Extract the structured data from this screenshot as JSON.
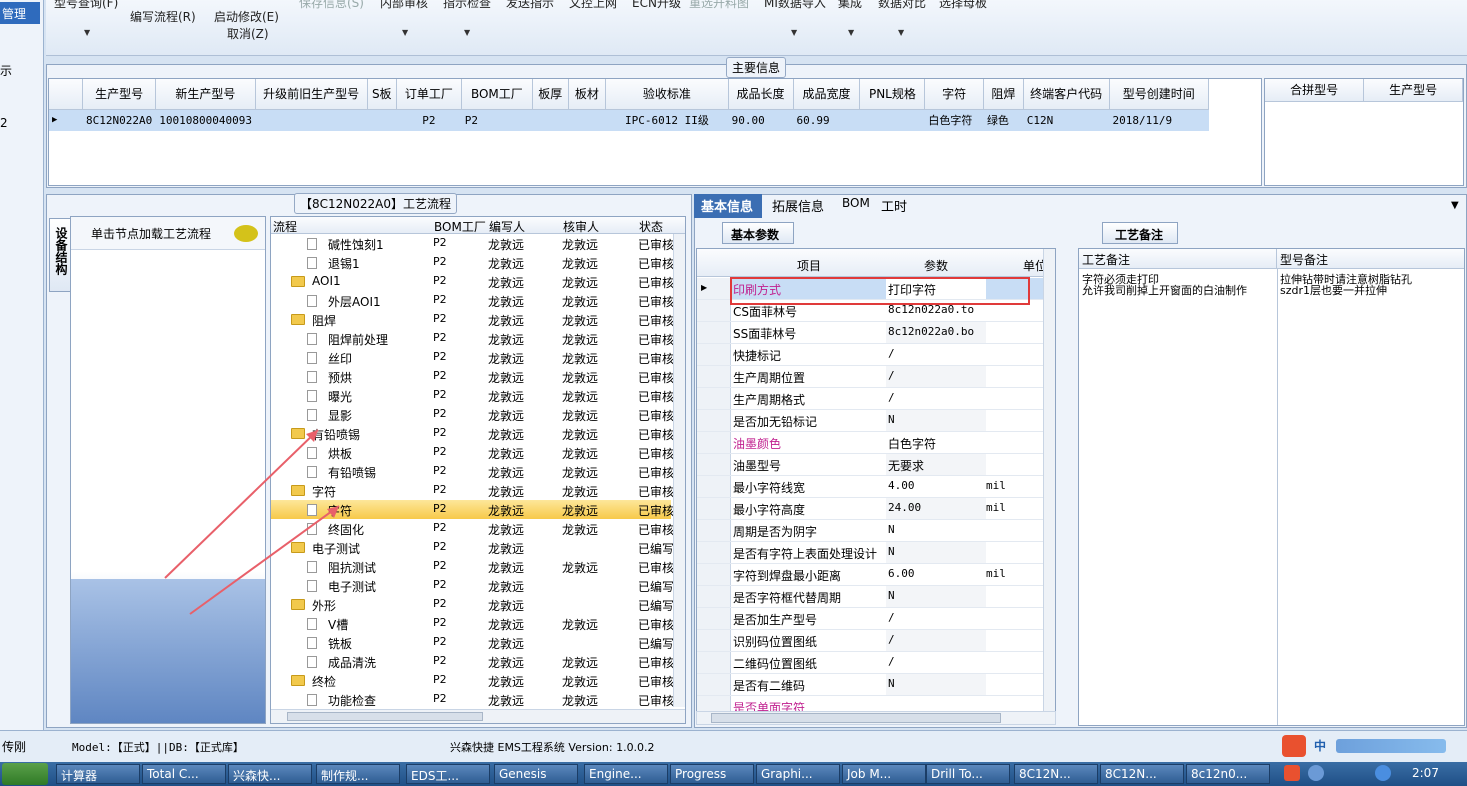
{
  "left_strip": {
    "selected": "管理",
    "item1": "示",
    "item2": "2"
  },
  "toolbar": {
    "items": [
      {
        "label": "型号查询(F)",
        "disabled": false
      },
      {
        "label": "编写流程(R)",
        "disabled": false
      },
      {
        "label": "启动修改(E)",
        "disabled": false
      },
      {
        "label": "取消(Z)",
        "disabled": false
      },
      {
        "label": "保存信息(S)",
        "disabled": true
      },
      {
        "label": "内部审核",
        "disabled": false
      },
      {
        "label": "指示检查",
        "disabled": false
      },
      {
        "label": "发送指示",
        "disabled": false
      },
      {
        "label": "文控上网",
        "disabled": false
      },
      {
        "label": "ECN升级",
        "disabled": false
      },
      {
        "label": "重选开料图",
        "disabled": true
      },
      {
        "label": "MI数据导入",
        "disabled": false
      },
      {
        "label": "集成",
        "disabled": false
      },
      {
        "label": "数据对比",
        "disabled": false
      },
      {
        "label": "选择母板",
        "disabled": false
      }
    ]
  },
  "main_info": {
    "title": "主要信息",
    "columns": [
      "生产型号",
      "新生产型号",
      "升级前旧生产型号",
      "S板",
      "订单工厂",
      "BOM工厂",
      "板厚",
      "板材",
      "验收标准",
      "成品长度",
      "成品宽度",
      "PNL规格",
      "字符",
      "阻焊",
      "终端客户代码",
      "型号创建时间"
    ],
    "row": [
      "8C12N022A0",
      "10010800040093",
      "",
      "",
      "P2",
      "P2",
      "",
      "",
      "IPC-6012 II级",
      "90.00",
      "60.99",
      "",
      "白色字符",
      "绿色",
      "C12N",
      "2018/11/9"
    ],
    "side_columns": [
      "合拼型号",
      "生产型号"
    ]
  },
  "process": {
    "title": "【8C12N022A0】工艺流程",
    "side_tab": "设备结构",
    "hint": "单击节点加载工艺流程",
    "columns": [
      "流程",
      "BOM工厂",
      "编写人",
      "核审人",
      "状态"
    ],
    "rows": [
      {
        "name": "碱性蚀刻1",
        "level": 2,
        "bom": "P2",
        "writer": "龙敦远",
        "checker": "龙敦远",
        "status": "已审核",
        "folder": false
      },
      {
        "name": "退锡1",
        "level": 2,
        "bom": "P2",
        "writer": "龙敦远",
        "checker": "龙敦远",
        "status": "已审核",
        "folder": false
      },
      {
        "name": "AOI1",
        "level": 1,
        "bom": "P2",
        "writer": "龙敦远",
        "checker": "龙敦远",
        "status": "已审核",
        "folder": true
      },
      {
        "name": "外层AOI1",
        "level": 2,
        "bom": "P2",
        "writer": "龙敦远",
        "checker": "龙敦远",
        "status": "已审核",
        "folder": false
      },
      {
        "name": "阻焊",
        "level": 1,
        "bom": "P2",
        "writer": "龙敦远",
        "checker": "龙敦远",
        "status": "已审核",
        "folder": true
      },
      {
        "name": "阻焊前处理",
        "level": 2,
        "bom": "P2",
        "writer": "龙敦远",
        "checker": "龙敦远",
        "status": "已审核",
        "folder": false
      },
      {
        "name": "丝印",
        "level": 2,
        "bom": "P2",
        "writer": "龙敦远",
        "checker": "龙敦远",
        "status": "已审核",
        "folder": false
      },
      {
        "name": "预烘",
        "level": 2,
        "bom": "P2",
        "writer": "龙敦远",
        "checker": "龙敦远",
        "status": "已审核",
        "folder": false
      },
      {
        "name": "曝光",
        "level": 2,
        "bom": "P2",
        "writer": "龙敦远",
        "checker": "龙敦远",
        "status": "已审核",
        "folder": false
      },
      {
        "name": "显影",
        "level": 2,
        "bom": "P2",
        "writer": "龙敦远",
        "checker": "龙敦远",
        "status": "已审核",
        "folder": false
      },
      {
        "name": "有铅喷锡",
        "level": 1,
        "bom": "P2",
        "writer": "龙敦远",
        "checker": "龙敦远",
        "status": "已审核",
        "folder": true
      },
      {
        "name": "烘板",
        "level": 2,
        "bom": "P2",
        "writer": "龙敦远",
        "checker": "龙敦远",
        "status": "已审核",
        "folder": false
      },
      {
        "name": "有铅喷锡",
        "level": 2,
        "bom": "P2",
        "writer": "龙敦远",
        "checker": "龙敦远",
        "status": "已审核",
        "folder": false
      },
      {
        "name": "字符",
        "level": 1,
        "bom": "P2",
        "writer": "龙敦远",
        "checker": "龙敦远",
        "status": "已审核",
        "folder": true
      },
      {
        "name": "字符",
        "level": 2,
        "bom": "P2",
        "writer": "龙敦远",
        "checker": "龙敦远",
        "status": "已审核",
        "folder": false,
        "selected": true
      },
      {
        "name": "终固化",
        "level": 2,
        "bom": "P2",
        "writer": "龙敦远",
        "checker": "龙敦远",
        "status": "已审核",
        "folder": false
      },
      {
        "name": "电子测试",
        "level": 1,
        "bom": "P2",
        "writer": "龙敦远",
        "checker": "",
        "status": "已编写",
        "folder": true
      },
      {
        "name": "阻抗测试",
        "level": 2,
        "bom": "P2",
        "writer": "龙敦远",
        "checker": "龙敦远",
        "status": "已审核",
        "folder": false
      },
      {
        "name": "电子测试",
        "level": 2,
        "bom": "P2",
        "writer": "龙敦远",
        "checker": "",
        "status": "已编写",
        "folder": false
      },
      {
        "name": "外形",
        "level": 1,
        "bom": "P2",
        "writer": "龙敦远",
        "checker": "",
        "status": "已编写",
        "folder": true
      },
      {
        "name": "V槽",
        "level": 2,
        "bom": "P2",
        "writer": "龙敦远",
        "checker": "龙敦远",
        "status": "已审核",
        "folder": false
      },
      {
        "name": "铣板",
        "level": 2,
        "bom": "P2",
        "writer": "龙敦远",
        "checker": "",
        "status": "已编写",
        "folder": false
      },
      {
        "name": "成品清洗",
        "level": 2,
        "bom": "P2",
        "writer": "龙敦远",
        "checker": "龙敦远",
        "status": "已审核",
        "folder": false
      },
      {
        "name": "终检",
        "level": 1,
        "bom": "P2",
        "writer": "龙敦远",
        "checker": "龙敦远",
        "status": "已审核",
        "folder": true
      },
      {
        "name": "功能检查",
        "level": 2,
        "bom": "P2",
        "writer": "龙敦远",
        "checker": "龙敦远",
        "status": "已审核",
        "folder": false
      }
    ]
  },
  "detail_tabs": [
    "基本信息",
    "拓展信息",
    "BOM",
    "工时"
  ],
  "basic_params": {
    "title": "基本参数",
    "columns": [
      "项目",
      "参数",
      "单位"
    ],
    "rows": [
      {
        "item": "印刷方式",
        "value": "打印字符",
        "unit": "",
        "highlight": true
      },
      {
        "item": "CS面菲林号",
        "value": "8c12n022a0.to",
        "unit": ""
      },
      {
        "item": "SS面菲林号",
        "value": "8c12n022a0.bo",
        "unit": ""
      },
      {
        "item": "快捷标记",
        "value": "/",
        "unit": ""
      },
      {
        "item": "生产周期位置",
        "value": "/",
        "unit": ""
      },
      {
        "item": "生产周期格式",
        "value": "/",
        "unit": ""
      },
      {
        "item": "是否加无铅标记",
        "value": "N",
        "unit": ""
      },
      {
        "item": "油墨颜色",
        "value": "白色字符",
        "unit": "",
        "pink": true
      },
      {
        "item": "油墨型号",
        "value": "无要求",
        "unit": ""
      },
      {
        "item": "最小字符线宽",
        "value": "4.00",
        "unit": "mil"
      },
      {
        "item": "最小字符高度",
        "value": "24.00",
        "unit": "mil"
      },
      {
        "item": "周期是否为阴字",
        "value": "N",
        "unit": ""
      },
      {
        "item": "是否有字符上表面处理设计",
        "value": "N",
        "unit": ""
      },
      {
        "item": "字符到焊盘最小距离",
        "value": "6.00",
        "unit": "mil"
      },
      {
        "item": "是否字符框代替周期",
        "value": "N",
        "unit": ""
      },
      {
        "item": "是否加生产型号",
        "value": "/",
        "unit": ""
      },
      {
        "item": "识别码位置图纸",
        "value": "/",
        "unit": ""
      },
      {
        "item": "二维码位置图纸",
        "value": "/",
        "unit": ""
      },
      {
        "item": "是否有二维码",
        "value": "N",
        "unit": ""
      },
      {
        "item": "是否单面字符",
        "value": "",
        "unit": "",
        "pink": true
      }
    ]
  },
  "remarks": {
    "title": "工艺备注",
    "col1": "工艺备注",
    "col2": "型号备注",
    "text1": "字符必须走打印\n允许我司削掉上开窗面的白油制作",
    "text2": "拉伸钻带时请注意树脂钻孔\nszdr1层也要一并拉伸"
  },
  "status_bar": {
    "user": "传刚",
    "model": "Model:【正式】||DB:【正式库】",
    "app": "兴森快捷 EMS工程系统 Version: 1.0.0.2"
  },
  "taskbar": {
    "tasks": [
      "计算器",
      "Total C...",
      "兴森快...",
      "制作规...",
      "EDS工...",
      "Genesis",
      "Engine...",
      "Progress",
      "Graphi...",
      "Job M...",
      "Drill To...",
      "8C12N...",
      "8C12N...",
      "8c12n0..."
    ],
    "ime": "中",
    "clock": "2:07"
  }
}
